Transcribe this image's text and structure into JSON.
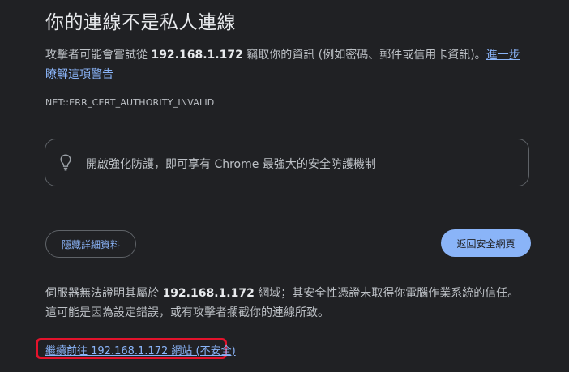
{
  "title": "你的連線不是私人連線",
  "description": {
    "part1": "攻擊者可能會嘗試從 ",
    "host": "192.168.1.172",
    "part2": " 竊取你的資訊 (例如密碼、郵件或信用卡資訊)。",
    "learn_more_link": "進一步瞭解這項警告"
  },
  "error_code": "NET::ERR_CERT_AUTHORITY_INVALID",
  "enhanced_protection": {
    "icon": "lightbulb-icon",
    "link_text": "開啟強化防護",
    "rest_text": "，即可享有 Chrome 最強大的安全防護機制"
  },
  "buttons": {
    "hide_details": "隱藏詳細資料",
    "back_to_safety": "返回安全網頁"
  },
  "explanation": {
    "part1": "伺服器無法證明其屬於 ",
    "host": "192.168.1.172",
    "part2": " 網域；其安全性憑證未取得你電腦作業系統的信任。這可能是因為設定錯誤，或有攻擊者攔截你的連線所致。"
  },
  "proceed_link": "繼續前往 192.168.1.172 網站 (不安全)",
  "colors": {
    "background": "#202124",
    "link": "#8ab4f8",
    "highlight_border": "#e3132c"
  }
}
